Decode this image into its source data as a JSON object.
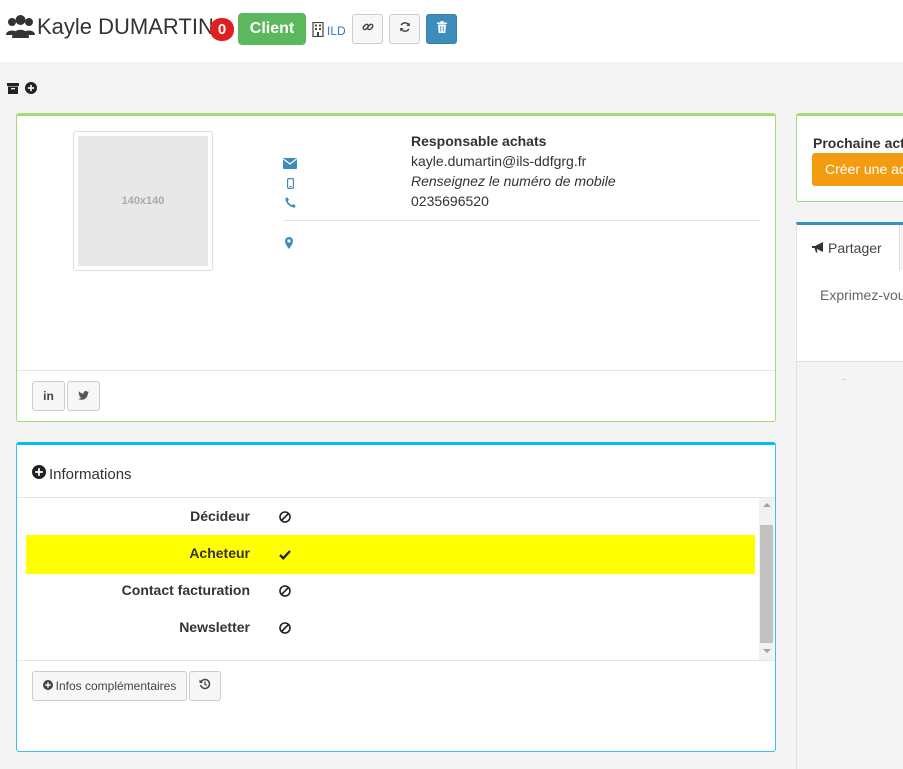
{
  "header": {
    "title": "Kayle DUMARTIN",
    "notification_count": "0",
    "status_label": "Client",
    "company_code": "ILD",
    "icons": [
      "users-icon",
      "building-icon",
      "link-icon",
      "refresh-icon",
      "trash-icon"
    ],
    "colors": {
      "count_badge": "#dd2020",
      "client_badge": "#5cb85c",
      "delete_button": "#3c8dbc"
    }
  },
  "toolbar": {
    "icons": [
      "archive-icon",
      "plus-circle-icon"
    ]
  },
  "contact": {
    "photo_placeholder": "140x140",
    "role": "Responsable achats",
    "email": "kayle.dumartin@ils-ddfgrg.fr",
    "mobile_placeholder": "Renseignez le numéro de mobile",
    "phone": "0235696520",
    "social": {
      "linkedin": "in",
      "twitter": "twitter-icon"
    }
  },
  "informations": {
    "title": "Informations",
    "rows": [
      {
        "label": "Décideur",
        "value_icon": "ban-icon",
        "highlighted": false
      },
      {
        "label": "Acheteur",
        "value_icon": "check-icon",
        "highlighted": true
      },
      {
        "label": "Contact facturation",
        "value_icon": "ban-icon",
        "highlighted": false
      },
      {
        "label": "Newsletter",
        "value_icon": "ban-icon",
        "highlighted": false
      }
    ],
    "more_button": "Infos complémentaires",
    "history_icon": "history-icon",
    "colors": {
      "highlight": "#ffff00",
      "accent": "#00c0ef"
    }
  },
  "next_action": {
    "title": "Prochaine actio",
    "button": "Créer une ac",
    "colors": {
      "button": "#f39c12"
    }
  },
  "share": {
    "tab_label": "Partager",
    "input_placeholder": "Exprimez-vou"
  }
}
